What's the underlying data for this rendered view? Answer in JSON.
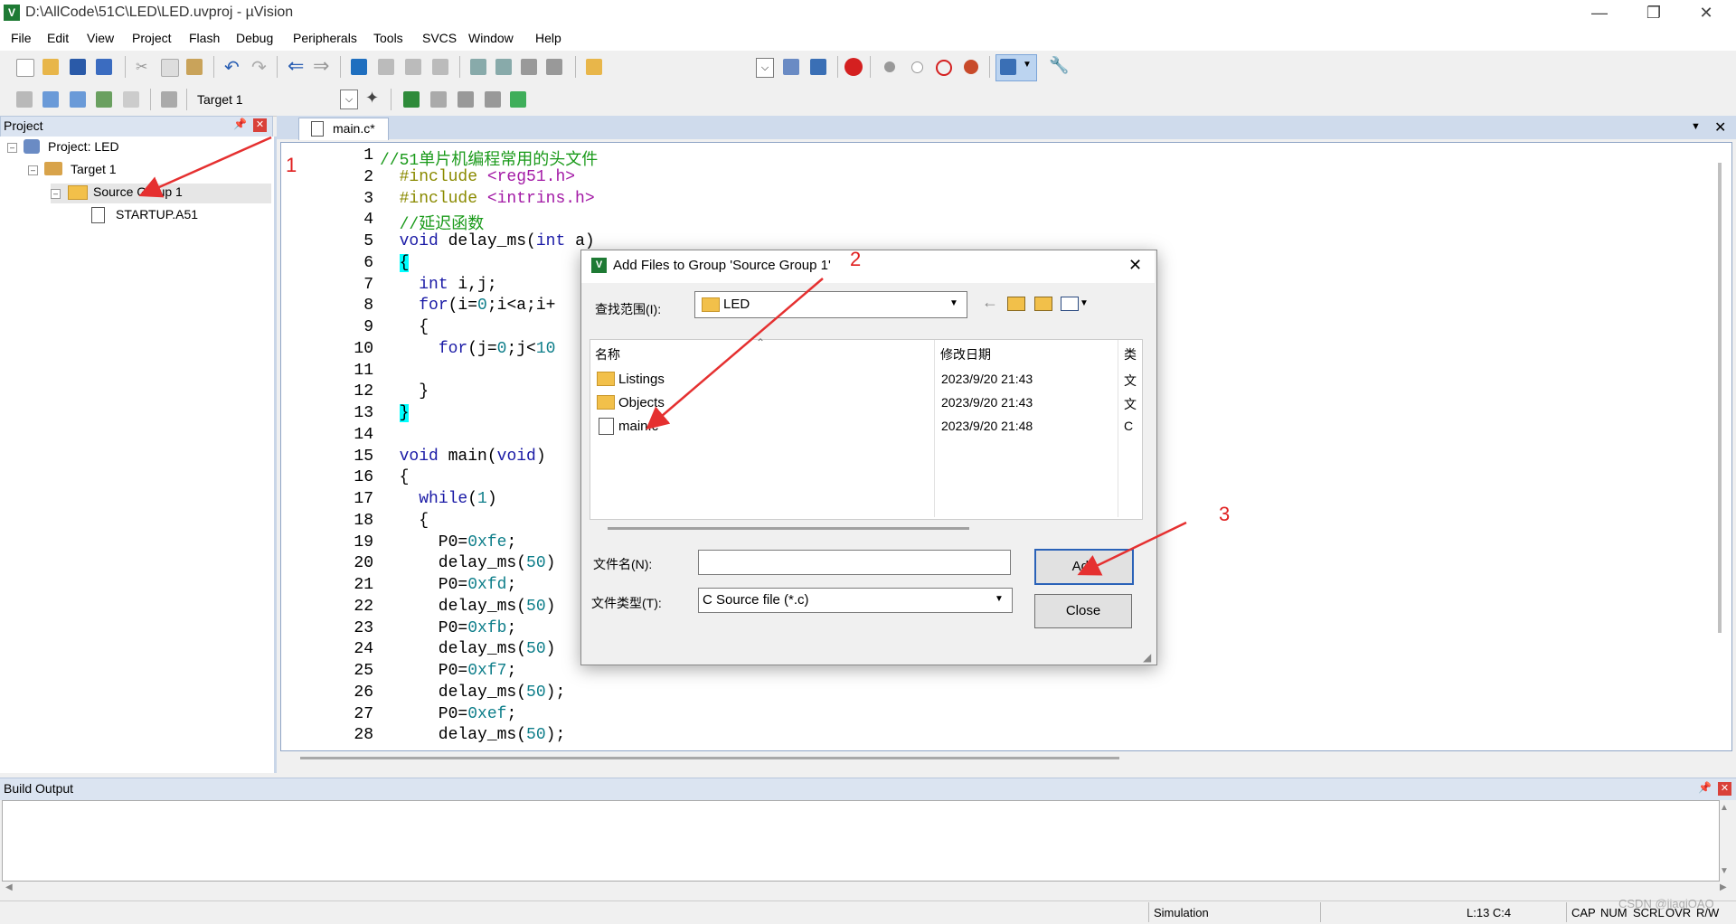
{
  "window": {
    "title": "D:\\AllCode\\51C\\LED\\LED.uvproj - µVision",
    "app_icon_letter": "V"
  },
  "menu": [
    "File",
    "Edit",
    "View",
    "Project",
    "Flash",
    "Debug",
    "Peripherals",
    "Tools",
    "SVCS",
    "Window",
    "Help"
  ],
  "toolbar2": {
    "target_select": "Target 1"
  },
  "project": {
    "panel_title": "Project",
    "root": "Project: LED",
    "target": "Target 1",
    "group": "Source Group 1",
    "file": "STARTUP.A51"
  },
  "editor": {
    "tab": "main.c*",
    "line_numbers": [
      "1",
      "2",
      "3",
      "4",
      "5",
      "6",
      "7",
      "8",
      "9",
      "10",
      "11",
      "12",
      "13",
      "14",
      "15",
      "16",
      "17",
      "18",
      "19",
      "20",
      "21",
      "22",
      "23",
      "24",
      "25",
      "26",
      "27",
      "28"
    ],
    "lines": [
      [
        {
          "t": "//51单片机编程常用的头文件",
          "c": "cm"
        }
      ],
      [
        {
          "t": "  ",
          "c": ""
        },
        {
          "t": "#include ",
          "c": "pp"
        },
        {
          "t": "<reg51.h>",
          "c": "str"
        }
      ],
      [
        {
          "t": "  ",
          "c": ""
        },
        {
          "t": "#include ",
          "c": "pp"
        },
        {
          "t": "<intrins.h>",
          "c": "str"
        }
      ],
      [
        {
          "t": "  //延迟函数",
          "c": "cm"
        }
      ],
      [
        {
          "t": "  ",
          "c": ""
        },
        {
          "t": "void",
          "c": "kw"
        },
        {
          "t": " delay_ms(",
          "c": ""
        },
        {
          "t": "int",
          "c": "kw"
        },
        {
          "t": " a)",
          "c": ""
        }
      ],
      [
        {
          "t": "  ",
          "c": ""
        },
        {
          "t": "{",
          "c": "brace"
        }
      ],
      [
        {
          "t": "    ",
          "c": ""
        },
        {
          "t": "int",
          "c": "kw"
        },
        {
          "t": " i,j;",
          "c": ""
        }
      ],
      [
        {
          "t": "    ",
          "c": ""
        },
        {
          "t": "for",
          "c": "kw"
        },
        {
          "t": "(i=",
          "c": ""
        },
        {
          "t": "0",
          "c": "num"
        },
        {
          "t": ";i<a;i+",
          "c": ""
        }
      ],
      [
        {
          "t": "    {",
          "c": ""
        }
      ],
      [
        {
          "t": "      ",
          "c": ""
        },
        {
          "t": "for",
          "c": "kw"
        },
        {
          "t": "(j=",
          "c": ""
        },
        {
          "t": "0",
          "c": "num"
        },
        {
          "t": ";j<",
          "c": ""
        },
        {
          "t": "10",
          "c": "num"
        }
      ],
      [
        {
          "t": "",
          "c": ""
        }
      ],
      [
        {
          "t": "    }",
          "c": ""
        }
      ],
      [
        {
          "t": "  ",
          "c": ""
        },
        {
          "t": "}",
          "c": "brace"
        }
      ],
      [
        {
          "t": "",
          "c": ""
        }
      ],
      [
        {
          "t": "  ",
          "c": ""
        },
        {
          "t": "void",
          "c": "kw"
        },
        {
          "t": " main(",
          "c": ""
        },
        {
          "t": "void",
          "c": "kw"
        },
        {
          "t": ")",
          "c": ""
        }
      ],
      [
        {
          "t": "  {",
          "c": ""
        }
      ],
      [
        {
          "t": "    ",
          "c": ""
        },
        {
          "t": "while",
          "c": "kw"
        },
        {
          "t": "(",
          "c": ""
        },
        {
          "t": "1",
          "c": "num"
        },
        {
          "t": ")",
          "c": ""
        }
      ],
      [
        {
          "t": "    {",
          "c": ""
        }
      ],
      [
        {
          "t": "      P0=",
          "c": ""
        },
        {
          "t": "0xfe",
          "c": "num"
        },
        {
          "t": ";",
          "c": ""
        }
      ],
      [
        {
          "t": "      delay_ms(",
          "c": ""
        },
        {
          "t": "50",
          "c": "num"
        },
        {
          "t": ")",
          "c": ""
        }
      ],
      [
        {
          "t": "      P0=",
          "c": ""
        },
        {
          "t": "0xfd",
          "c": "num"
        },
        {
          "t": ";",
          "c": ""
        }
      ],
      [
        {
          "t": "      delay_ms(",
          "c": ""
        },
        {
          "t": "50",
          "c": "num"
        },
        {
          "t": ")",
          "c": ""
        }
      ],
      [
        {
          "t": "      P0=",
          "c": ""
        },
        {
          "t": "0xfb",
          "c": "num"
        },
        {
          "t": ";",
          "c": ""
        }
      ],
      [
        {
          "t": "      delay_ms(",
          "c": ""
        },
        {
          "t": "50",
          "c": "num"
        },
        {
          "t": ")",
          "c": ""
        }
      ],
      [
        {
          "t": "      P0=",
          "c": ""
        },
        {
          "t": "0xf7",
          "c": "num"
        },
        {
          "t": ";",
          "c": ""
        }
      ],
      [
        {
          "t": "      delay_ms(",
          "c": ""
        },
        {
          "t": "50",
          "c": "num"
        },
        {
          "t": ");",
          "c": ""
        }
      ],
      [
        {
          "t": "      P0=",
          "c": ""
        },
        {
          "t": "0xef",
          "c": "num"
        },
        {
          "t": ";",
          "c": ""
        }
      ],
      [
        {
          "t": "      delay_ms(",
          "c": ""
        },
        {
          "t": "50",
          "c": "num"
        },
        {
          "t": ");",
          "c": ""
        }
      ]
    ]
  },
  "dialog": {
    "title": "Add Files to Group 'Source Group 1'",
    "look_in_label": "查找范围(I):",
    "look_in_value": "LED",
    "col_name": "名称",
    "col_date": "修改日期",
    "col_type": "类",
    "files": [
      {
        "name": "Listings",
        "date": "2023/9/20 21:43",
        "type": "文",
        "icon": "folder-icon"
      },
      {
        "name": "Objects",
        "date": "2023/9/20 21:43",
        "type": "文",
        "icon": "folder-icon"
      },
      {
        "name": "main.c",
        "date": "2023/9/20 21:48",
        "type": "C",
        "icon": "c-file-icon"
      }
    ],
    "filename_label": "文件名(N):",
    "filename_value": "",
    "filetype_label": "文件类型(T):",
    "filetype_value": "C Source file (*.c)",
    "add_button": "Add",
    "close_button": "Close"
  },
  "annotations": {
    "a1": "1",
    "a2": "2",
    "a3": "3"
  },
  "build": {
    "title": "Build Output"
  },
  "status": {
    "mode": "Simulation",
    "position": "L:13 C:4",
    "caps": "CAP",
    "num": "NUM",
    "scrl": "SCRL",
    "ovr": "OVR",
    "rw": "R/W",
    "watermark": "CSDN @jiaqiOAO"
  }
}
